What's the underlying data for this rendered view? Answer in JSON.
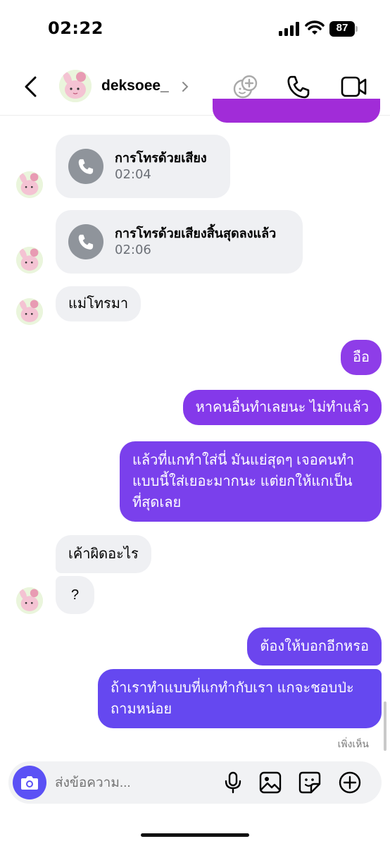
{
  "status_bar": {
    "time": "02:22",
    "battery": "87"
  },
  "header": {
    "username": "deksoee_"
  },
  "messages": {
    "call1": {
      "title": "การโทรด้วยเสียง",
      "time": "02:04"
    },
    "call2": {
      "title": "การโทรด้วยเสียงสิ้นสุดลงแล้ว",
      "time": "02:06"
    },
    "m1": "แม่โทรมา",
    "m2": "อือ",
    "m3": "หาคนอื่นทำเลยนะ ไม่ทำแล้ว",
    "m4_l1": "แล้วที่แกทำใส่นี่ มันแย่สุดๆ เจอคนทำ",
    "m4_l2": "แบบนี้ใส่เยอะมากนะ แต่ยกให้แกเป็น",
    "m4_l3": "ที่สุดเลย",
    "m5": "เค้าผิดอะไร",
    "m6": "?",
    "m7": "ต้องให้บอกอีกหรอ",
    "m8_l1": "ถ้าเราทำแบบที่แกทำกับเรา แกจะชอบป่ะ",
    "m8_l2": "ถามหน่อย"
  },
  "seen_label": "เพิ่งเห็น",
  "composer": {
    "placeholder": "ส่งข้อความ..."
  },
  "colors": {
    "accent": "#5b51f5",
    "bubble_out_top": "#a12cd8",
    "bubble_out_bottom": "#6548f0",
    "bubble_in": "#eff0f3"
  },
  "icons": [
    "back-icon",
    "add-emoji-icon",
    "phone-icon",
    "video-icon",
    "camera-icon",
    "microphone-icon",
    "image-icon",
    "sticker-icon",
    "plus-icon"
  ]
}
